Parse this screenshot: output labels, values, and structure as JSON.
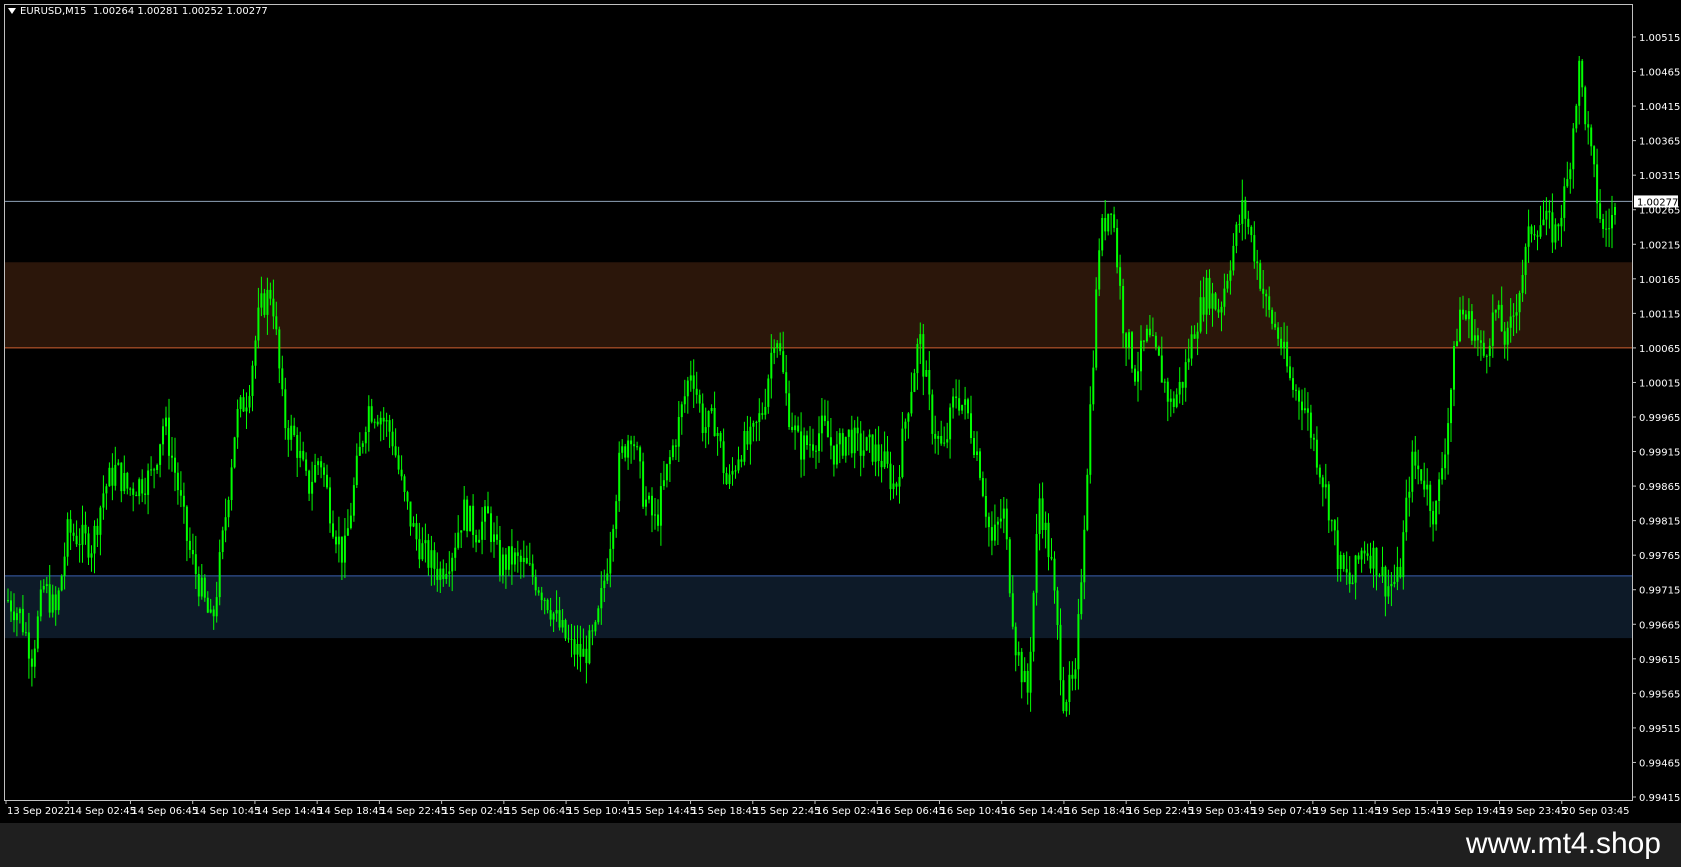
{
  "chart": {
    "symbol": "EURUSD,M15",
    "ohlc": "1.00264 1.00281 1.00252 1.00277",
    "current_price_label": "1.00277",
    "colors": {
      "background": "#000000",
      "candles": "#00ff00",
      "axis": "#c0c0c0",
      "current_price_line": "#8fa3b8",
      "resistance_zone_fill": "#2b160a",
      "resistance_zone_line": "#d06030",
      "support_zone_fill": "#0d1a28",
      "support_zone_line": "#3a5fb0",
      "text": "#ffffff"
    },
    "zones": {
      "resistance": {
        "from": 1.00065,
        "to": 1.00189
      },
      "support": {
        "from": 0.99645,
        "to": 0.99735
      }
    }
  },
  "chart_data": {
    "type": "candlestick",
    "title": "EURUSD,M15",
    "y_ticks": [
      "1.00515",
      "1.00465",
      "1.00415",
      "1.00365",
      "1.00315",
      "1.00265",
      "1.00215",
      "1.00165",
      "1.00115",
      "1.00065",
      "1.00015",
      "0.99965",
      "0.99915",
      "0.99865",
      "0.99815",
      "0.99765",
      "0.99715",
      "0.99665",
      "0.99615",
      "0.99565",
      "0.99515",
      "0.99465",
      "0.99415"
    ],
    "ylim": [
      0.99415,
      1.00515
    ],
    "x_ticks": [
      "13 Sep 2022",
      "14 Sep 02:45",
      "14 Sep 06:45",
      "14 Sep 10:45",
      "14 Sep 14:45",
      "14 Sep 18:45",
      "14 Sep 22:45",
      "15 Sep 02:45",
      "15 Sep 06:45",
      "15 Sep 10:45",
      "15 Sep 14:45",
      "15 Sep 18:45",
      "15 Sep 22:45",
      "16 Sep 02:45",
      "16 Sep 06:45",
      "16 Sep 10:45",
      "16 Sep 14:45",
      "16 Sep 18:45",
      "16 Sep 22:45",
      "19 Sep 03:45",
      "19 Sep 07:45",
      "19 Sep 11:45",
      "19 Sep 15:45",
      "19 Sep 19:45",
      "19 Sep 23:45",
      "20 Sep 03:45"
    ],
    "close_path": [
      0.997,
      0.9968,
      0.9962,
      0.9972,
      0.9968,
      0.998,
      0.9979,
      0.9978,
      0.9986,
      0.9989,
      0.9986,
      0.9987,
      0.9988,
      0.9996,
      0.9988,
      0.9978,
      0.9972,
      0.9966,
      0.998,
      0.9996,
      1.0,
      1.0012,
      1.0015,
      0.9996,
      0.9993,
      0.9986,
      0.9991,
      0.9982,
      0.9976,
      0.9988,
      0.9998,
      0.9997,
      0.9994,
      0.9985,
      0.9979,
      0.9976,
      0.9974,
      0.9977,
      0.9983,
      0.998,
      0.9982,
      0.9975,
      0.9976,
      0.9975,
      0.9973,
      0.997,
      0.9966,
      0.9963,
      0.9962,
      0.9965,
      0.9976,
      0.999,
      0.9995,
      0.9985,
      0.9981,
      0.9989,
      0.9996,
      1.0004,
      0.9995,
      0.9996,
      0.9986,
      0.9992,
      0.9993,
      0.9998,
      1.001,
      0.9998,
      0.9992,
      0.9993,
      0.9995,
      0.9991,
      0.9994,
      0.9992,
      0.9992,
      0.999,
      0.9986,
      0.9998,
      1.0008,
      0.9996,
      0.9991,
      1.0,
      0.9997,
      0.999,
      0.9978,
      0.9983,
      0.9964,
      0.9956,
      0.9985,
      0.9975,
      0.9956,
      0.9958,
      0.999,
      1.0022,
      1.0028,
      1.001,
      1.0003,
      1.0008,
      1.0004,
      0.9998,
      1.0002,
      1.001,
      1.0015,
      1.0012,
      1.002,
      1.0027,
      1.002,
      1.0012,
      1.0008,
      1.0001,
      0.9999,
      0.9992,
      0.9985,
      0.9975,
      0.9972,
      0.9978,
      0.9976,
      0.9972,
      0.9973,
      0.999,
      0.9988,
      0.9982,
      0.9995,
      1.0012,
      1.001,
      1.0005,
      1.0012,
      1.0007,
      1.0015,
      1.0024,
      1.0025,
      1.0023,
      1.003,
      1.0047,
      1.0034,
      1.0023,
      1.0026
    ]
  },
  "footer": {
    "watermark": "www.mt4.shop"
  }
}
